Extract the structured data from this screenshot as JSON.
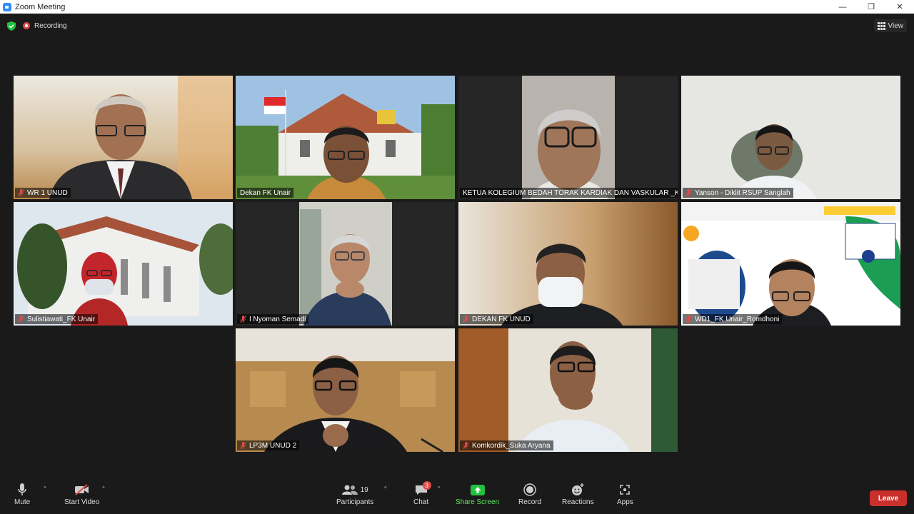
{
  "window": {
    "title": "Zoom Meeting",
    "minimize": "—",
    "restore": "❐",
    "close": "✕"
  },
  "status": {
    "recording": "Recording",
    "view": "View"
  },
  "tiles": [
    {
      "name": "WR 1 UNUD"
    },
    {
      "name": "Dekan FK Unair"
    },
    {
      "name": "KETUA KOLEGIUM BEDAH TORAK KARDIAK DAN VASKULAR _K..."
    },
    {
      "name": "Yanson - Diklit RSUP Sanglah"
    },
    {
      "name": "Sulistiawati_FK Unair"
    },
    {
      "name": "I Nyoman Semadi"
    },
    {
      "name": "DEKAN FK UNUD"
    },
    {
      "name": "WD1_FK Unair_Romdhoni"
    },
    {
      "name": "LP3M UNUD 2"
    },
    {
      "name": "Komkordik_Suka Aryana"
    }
  ],
  "toolbar": {
    "mute": "Mute",
    "start_video": "Start Video",
    "participants": "Participants",
    "participants_count": "19",
    "chat": "Chat",
    "chat_badge": "3",
    "share_screen": "Share Screen",
    "record": "Record",
    "reactions": "Reactions",
    "apps": "Apps",
    "leave": "Leave"
  },
  "colors": {
    "active_speaker": "#d8e04f",
    "leave": "#c9302c",
    "share": "#23c140",
    "recording": "#e24b4b"
  }
}
